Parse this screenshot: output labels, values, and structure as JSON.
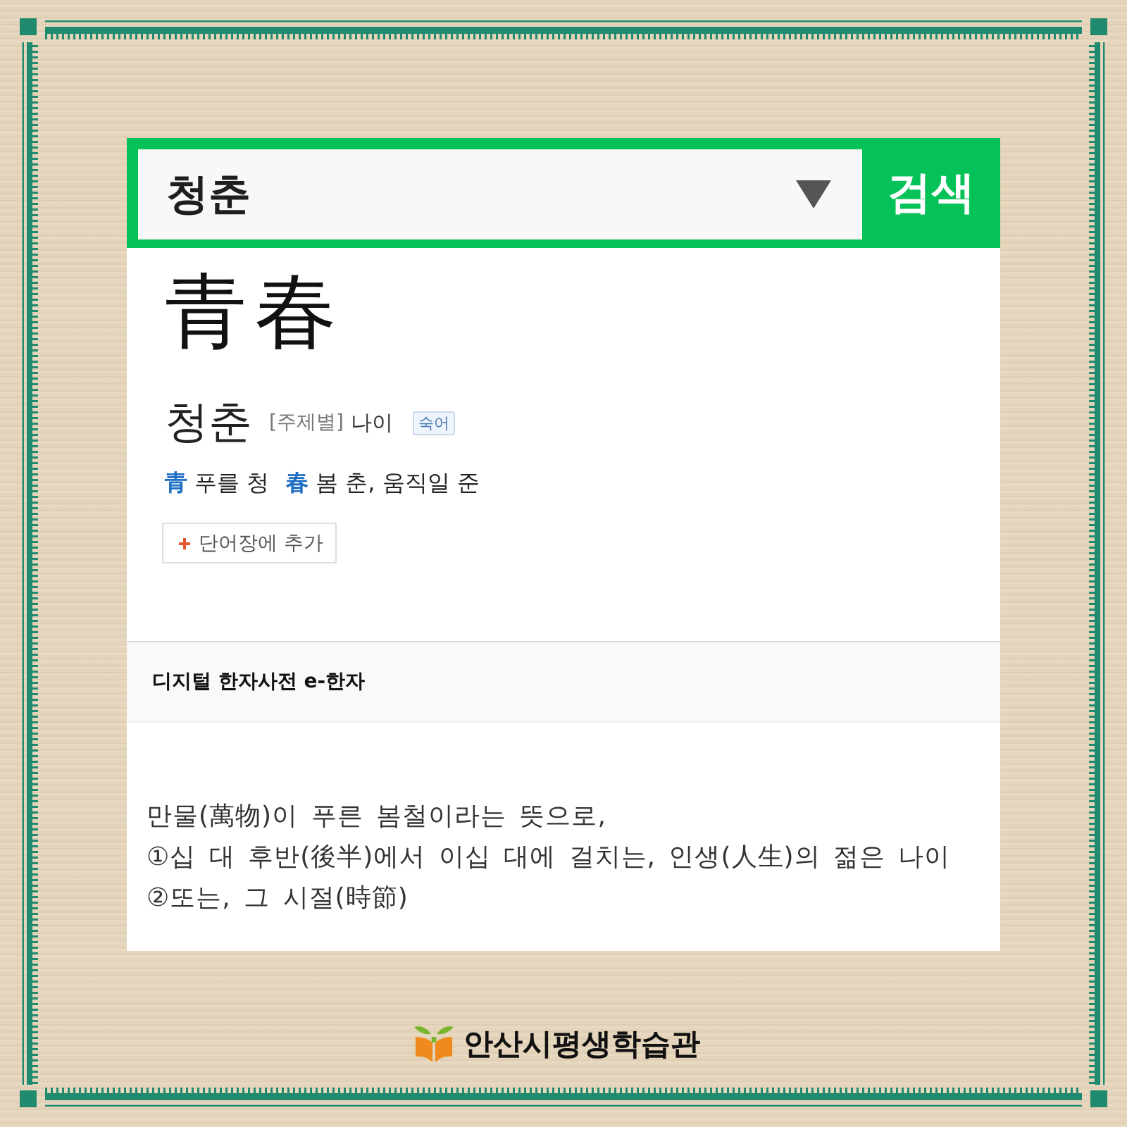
{
  "search": {
    "value": "청춘",
    "button": "검색"
  },
  "entry": {
    "hanja": "青春",
    "reading": "청춘",
    "category": "[주제별]",
    "topic": "나이",
    "tag": "숙어",
    "characters": [
      {
        "hanja": "青",
        "meaning": "푸를 청"
      },
      {
        "hanja": "春",
        "meaning": "봄 춘, 움직일 준"
      }
    ],
    "add_button": "단어장에 추가"
  },
  "source": {
    "title": "디지털 한자사전 e-한자"
  },
  "definition": {
    "lines": [
      "만물(萬物)이 푸른 봄철이라는 뜻으로,",
      "①십 대 후반(後半)에서 이십 대에 걸치는, 인생(人生)의 젊은 나이",
      "②또는, 그 시절(時節)"
    ]
  },
  "footer": {
    "logo_text": "안산시평생학습관"
  }
}
